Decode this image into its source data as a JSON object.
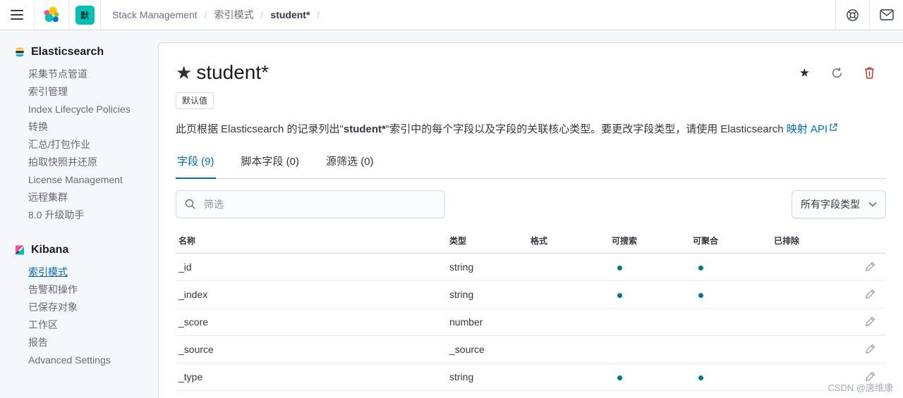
{
  "header": {
    "space_badge": "默",
    "breadcrumbs": [
      {
        "label": "Stack Management",
        "current": false
      },
      {
        "label": "索引模式",
        "current": false
      },
      {
        "label": "student*",
        "current": true
      }
    ]
  },
  "sidebar": {
    "sections": [
      {
        "title": "Elasticsearch",
        "items": [
          {
            "label": "采集节点管道",
            "active": false
          },
          {
            "label": "索引管理",
            "active": false
          },
          {
            "label": "Index Lifecycle Policies",
            "active": false
          },
          {
            "label": "转换",
            "active": false
          },
          {
            "label": "汇总/打包作业",
            "active": false
          },
          {
            "label": "拍取快照并还原",
            "active": false
          },
          {
            "label": "License Management",
            "active": false
          },
          {
            "label": "远程集群",
            "active": false
          },
          {
            "label": "8.0 升级助手",
            "active": false
          }
        ]
      },
      {
        "title": "Kibana",
        "items": [
          {
            "label": "索引模式",
            "active": true
          },
          {
            "label": "告警和操作",
            "active": false
          },
          {
            "label": "已保存对象",
            "active": false
          },
          {
            "label": "工作区",
            "active": false
          },
          {
            "label": "报告",
            "active": false
          },
          {
            "label": "Advanced Settings",
            "active": false
          }
        ]
      }
    ]
  },
  "main": {
    "title": "student*",
    "default_badge": "默认值",
    "description": {
      "part1": "此页根据 Elasticsearch 的记录列出\"",
      "bold": "student*",
      "part2": "\"索引中的每个字段以及字段的关联核心类型。要更改字段类型，请使用 Elasticsearch ",
      "link": "映射 API"
    },
    "tabs": [
      {
        "label": "字段 (9)",
        "active": true
      },
      {
        "label": "脚本字段 (0)",
        "active": false
      },
      {
        "label": "源筛选 (0)",
        "active": false
      }
    ],
    "filter_placeholder": "筛选",
    "type_filter_value": "所有字段类型",
    "table": {
      "headers": [
        "名称",
        "类型",
        "格式",
        "可搜索",
        "可聚合",
        "已排除"
      ],
      "rows": [
        {
          "name": "_id",
          "type": "string",
          "format": "",
          "searchable": true,
          "aggregatable": true,
          "excluded": false
        },
        {
          "name": "_index",
          "type": "string",
          "format": "",
          "searchable": true,
          "aggregatable": true,
          "excluded": false
        },
        {
          "name": "_score",
          "type": "number",
          "format": "",
          "searchable": false,
          "aggregatable": false,
          "excluded": false
        },
        {
          "name": "_source",
          "type": "_source",
          "format": "",
          "searchable": false,
          "aggregatable": false,
          "excluded": false
        },
        {
          "name": "_type",
          "type": "string",
          "format": "",
          "searchable": true,
          "aggregatable": true,
          "excluded": false
        }
      ]
    }
  },
  "watermark": "CSDN @唐维康",
  "colors": {
    "accent_teal": "#00BFB3",
    "link_blue": "#006BB4",
    "dot_teal": "#017D73",
    "danger_red": "#BD271E"
  }
}
